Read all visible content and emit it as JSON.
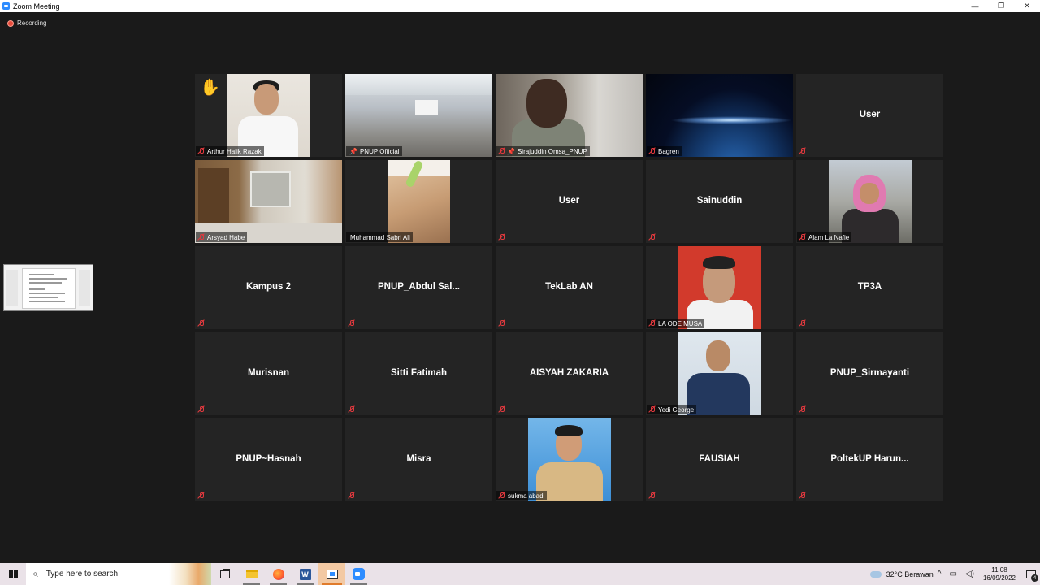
{
  "window": {
    "title": "Zoom Meeting",
    "minimize": "—",
    "restore": "❐",
    "close": "✕"
  },
  "recording": {
    "label": "Recording"
  },
  "tiles": [
    {
      "name": "Arthur Halik Razak",
      "type": "video",
      "hand_raised": true,
      "hand": "✋"
    },
    {
      "name": "PNUP Official",
      "type": "video",
      "active": true,
      "pinned": true,
      "pin": "📌"
    },
    {
      "name": "Sirajuddin Omsa_PNUP",
      "type": "video",
      "pinned": true,
      "pin": "📌"
    },
    {
      "name": "Bagren",
      "type": "video"
    },
    {
      "center": "User",
      "type": "avatar"
    },
    {
      "name": "Arsyad Habe",
      "type": "video"
    },
    {
      "name": "Muhammad Sabri Ali",
      "type": "video"
    },
    {
      "center": "User",
      "type": "avatar"
    },
    {
      "center": "Sainuddin",
      "type": "avatar"
    },
    {
      "name": "Alam La Nafie",
      "type": "video"
    },
    {
      "center": "Kampus 2",
      "type": "avatar"
    },
    {
      "center": "PNUP_Abdul  Sal...",
      "type": "avatar"
    },
    {
      "center": "TekLab AN",
      "type": "avatar"
    },
    {
      "name": "LA ODE MUSA",
      "type": "video"
    },
    {
      "center": "TP3A",
      "type": "avatar"
    },
    {
      "center": "Murisnan",
      "type": "avatar"
    },
    {
      "center": "Sitti Fatimah",
      "type": "avatar"
    },
    {
      "center": "AISYAH ZAKARIA",
      "type": "avatar"
    },
    {
      "name": "Yedi George",
      "type": "video"
    },
    {
      "center": "PNUP_Sirmayanti",
      "type": "avatar"
    },
    {
      "center": "PNUP~Hasnah",
      "type": "avatar"
    },
    {
      "center": "Misra",
      "type": "avatar"
    },
    {
      "name": "sukma abadi",
      "type": "video"
    },
    {
      "center": "FAUSIAH",
      "type": "avatar"
    },
    {
      "center": "PoltekUP  Harun...",
      "type": "avatar"
    }
  ],
  "taskbar": {
    "search_placeholder": "Type here to search",
    "search_glyph": "⌕",
    "apps": [
      "task-view",
      "file-explorer",
      "firefox",
      "word",
      "screen-share",
      "zoom"
    ],
    "word_letter": "W",
    "weather": "32°C  Berawan",
    "tray_up": "^",
    "tray_network": "▭",
    "tray_volume": "◁)",
    "time": "11:08",
    "date": "16/09/2022",
    "notifications": "4"
  }
}
